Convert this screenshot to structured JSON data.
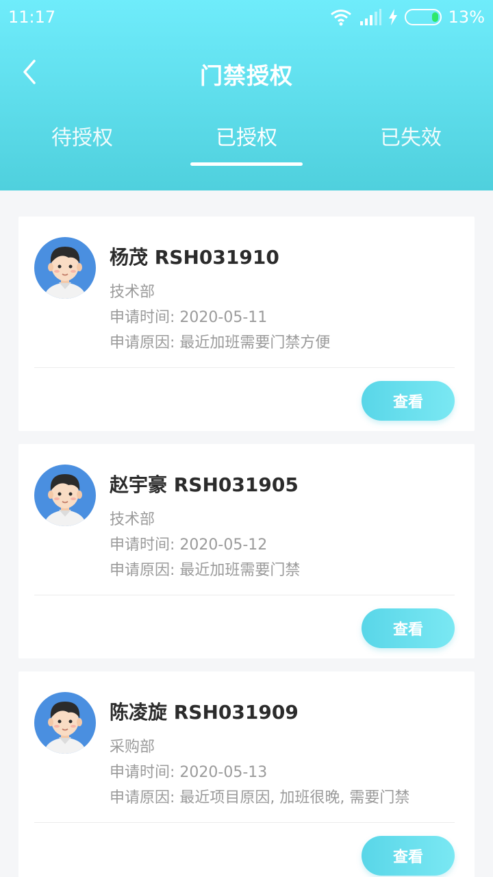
{
  "status_bar": {
    "time": "11:17",
    "battery_percent": "13%",
    "icons": [
      "wifi-icon",
      "signal-icon",
      "charging-bolt-icon",
      "battery-icon"
    ]
  },
  "header": {
    "title": "门禁授权",
    "back_icon": "chevron-left-icon",
    "gradient_colors": [
      "#6fecfb",
      "#4fd0dd"
    ]
  },
  "tabs": [
    {
      "label": "待授权",
      "active": false
    },
    {
      "label": "已授权",
      "active": true
    },
    {
      "label": "已失效",
      "active": false
    }
  ],
  "cards": [
    {
      "name": "杨茂 RSH031910",
      "department": "技术部",
      "apply_time": "申请时间: 2020-05-11",
      "reason": "申请原因: 最近加班需要门禁方便",
      "button_label": "查看"
    },
    {
      "name": "赵宇豪 RSH031905",
      "department": "技术部",
      "apply_time": "申请时间: 2020-05-12",
      "reason": "申请原因: 最近加班需要门禁",
      "button_label": "查看"
    },
    {
      "name": "陈凌旋 RSH031909",
      "department": "采购部",
      "apply_time": "申请时间: 2020-05-13",
      "reason": "申请原因: 最近项目原因, 加班很晚, 需要门禁",
      "button_label": "查看"
    }
  ],
  "colors": {
    "accent": "#59d6e8",
    "page_background": "#f5f6f8",
    "name_text": "#2b2b2b",
    "secondary_text": "#9a9a9a"
  }
}
